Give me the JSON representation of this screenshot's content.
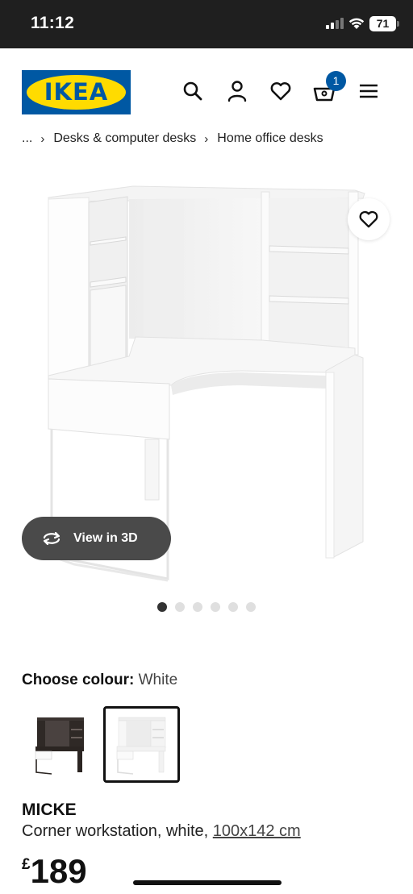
{
  "status_bar": {
    "time": "11:12",
    "battery": "71"
  },
  "header": {
    "logo_text": "IKEA",
    "logo_colors": {
      "blue": "#0058a3",
      "yellow": "#ffdb00"
    },
    "icons": [
      "search-icon",
      "account-icon",
      "wishlist-icon",
      "basket-icon",
      "menu-icon"
    ],
    "cart_count": "1"
  },
  "breadcrumb": {
    "ellipsis": "...",
    "items": [
      "Desks & computer desks",
      "Home office desks"
    ]
  },
  "gallery": {
    "view_3d_label": "View in 3D",
    "dot_count": 6,
    "active_dot": 1
  },
  "colour": {
    "label": "Choose colour:",
    "value": "White",
    "swatches": [
      "black-brown",
      "white"
    ]
  },
  "product": {
    "name": "MICKE",
    "description": "Corner workstation, white,",
    "dimensions": "100x142 cm",
    "price_currency": "£",
    "price_amount": "189"
  }
}
